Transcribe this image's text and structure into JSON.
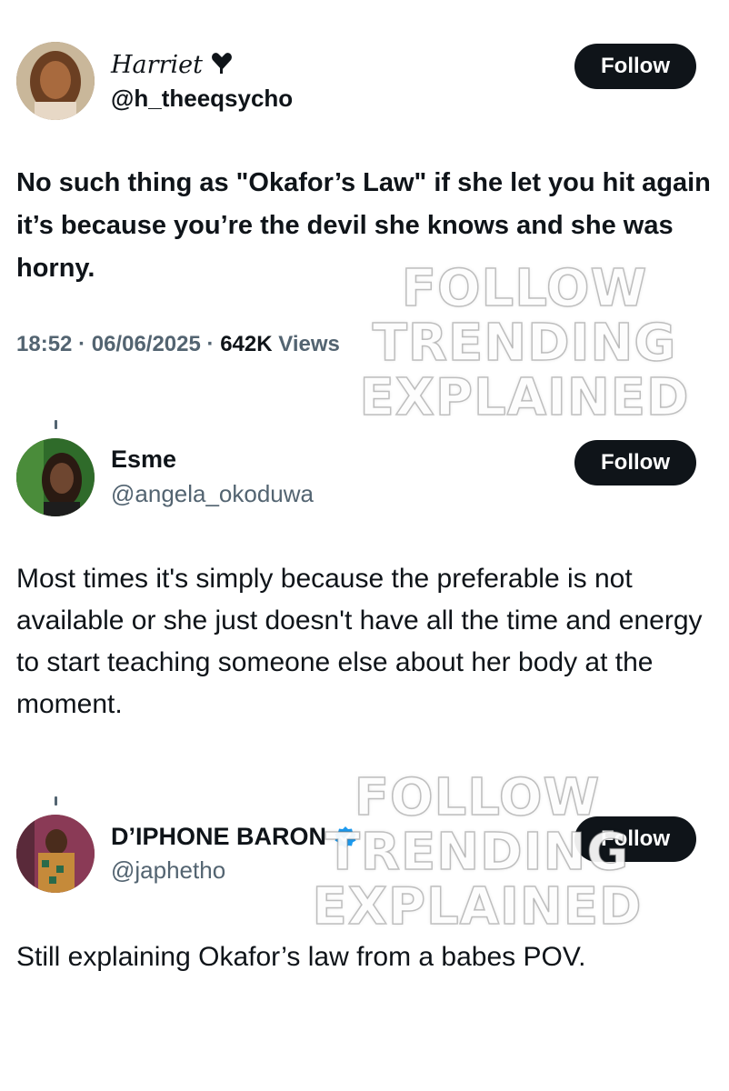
{
  "tweets": [
    {
      "name": "Harriet",
      "name_emoji": "heart-drip",
      "handle": "@h_theeqsycho",
      "follow_label": "Follow",
      "text": "No such thing as \"Okafor’s Law\" if she let you hit again it’s because you’re the devil she knows and she was horny.",
      "time": "18:52",
      "date": "06/06/2025",
      "views_count": "642K",
      "views_label": "Views"
    },
    {
      "name": "Esme",
      "handle": "@angela_okoduwa",
      "follow_label": "Follow",
      "text": "Most times it's simply because the preferable is not available or she just doesn't have all the time and energy to start teaching someone else about her body at the moment."
    },
    {
      "name": "D’IPHONE BARON",
      "verified": true,
      "handle": "@japhetho",
      "follow_label": "Follow",
      "text": "Still explaining Okafor’s law from a babes POV."
    }
  ],
  "watermark": {
    "line1": "FOLLOW",
    "line2": "TRENDING",
    "line3": "EXPLAINED"
  },
  "colors": {
    "text_primary": "#0f1419",
    "text_secondary": "#536471",
    "button_bg": "#0f1419",
    "verified_blue": "#1d9bf0"
  }
}
